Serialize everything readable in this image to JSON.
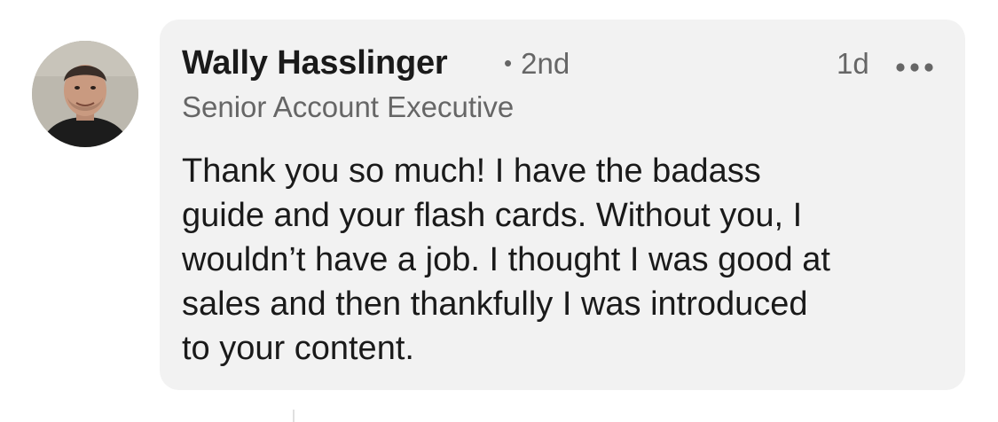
{
  "comment": {
    "author": {
      "name": "Wally Hasslinger",
      "connection_degree": "2nd",
      "degree_separator": "•",
      "headline": "Senior Account Executive",
      "avatar_icon": "profile-photo"
    },
    "timestamp": "1d",
    "more_icon": "more-horizontal-icon",
    "body_lines": [
      "Thank you so much! I have the badass",
      "guide and your flash cards. Without you, I",
      "wouldn’t have a job. I thought I was good at",
      "sales and then thankfully I was introduced",
      "to your content."
    ]
  },
  "colors": {
    "bubble_background": "#f2f2f2",
    "primary_text": "#1a1a1a",
    "secondary_text": "#666666"
  }
}
